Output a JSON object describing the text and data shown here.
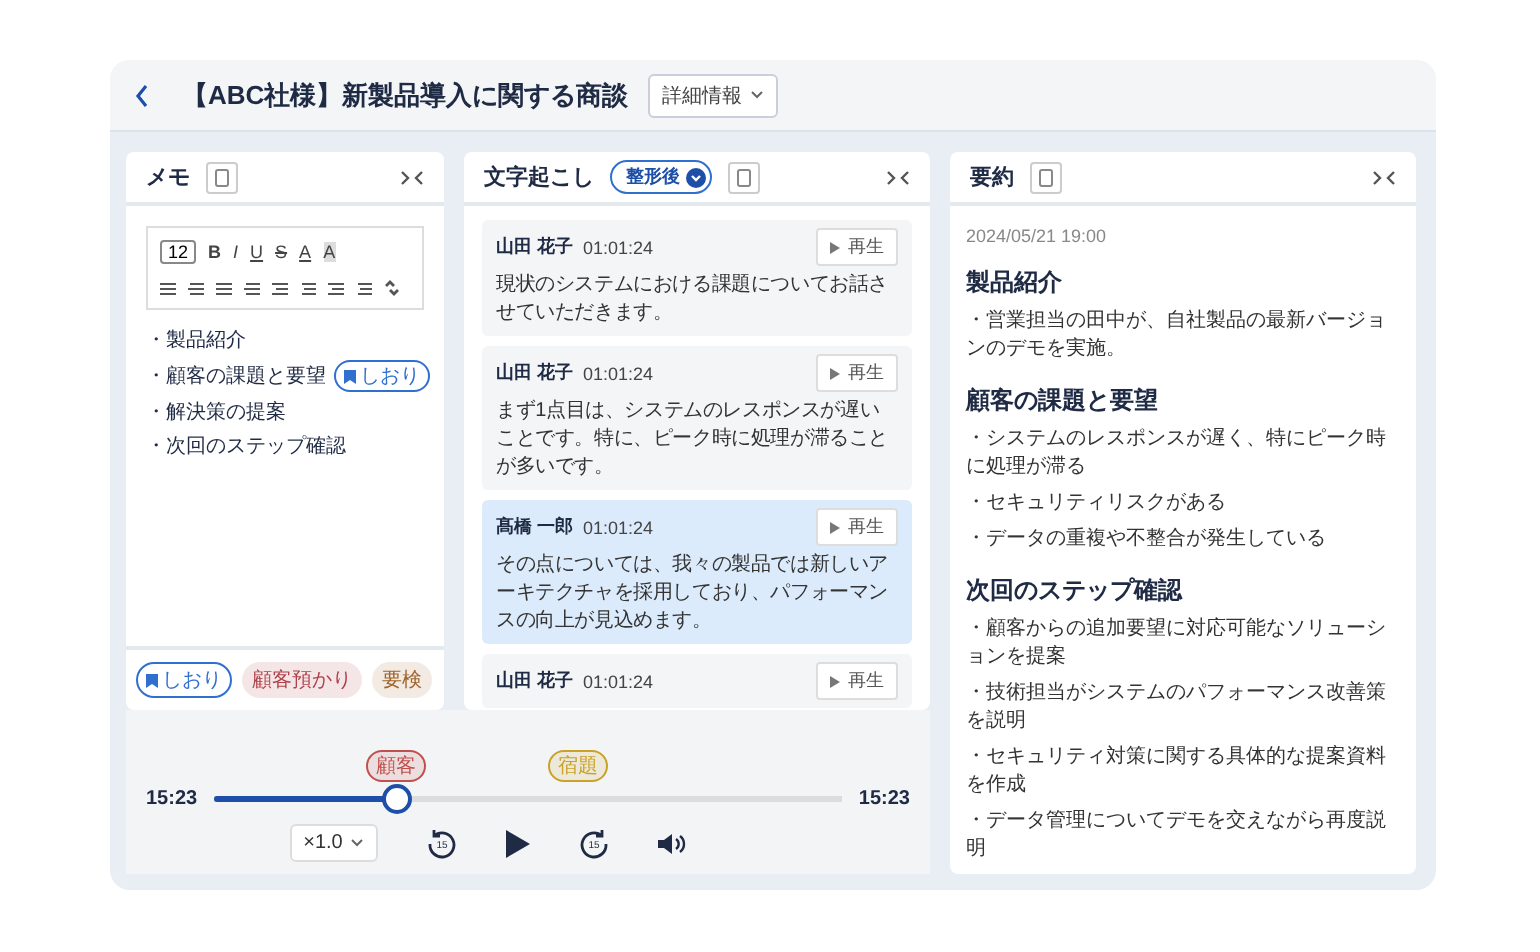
{
  "header": {
    "title": "【ABC社様】新製品導入に関する商談",
    "details_button": "詳細情報"
  },
  "memo": {
    "title": "メモ",
    "toolbar": {
      "font_size": "12",
      "buttons": [
        {
          "label": "B",
          "kind": "bold"
        },
        {
          "label": "I",
          "kind": "italic"
        },
        {
          "label": "U",
          "kind": "underline"
        },
        {
          "label": "S",
          "kind": "strike"
        },
        {
          "label": "A",
          "kind": "color"
        },
        {
          "label": "A",
          "kind": "highlight"
        }
      ]
    },
    "items": [
      {
        "text": "・製品紹介"
      },
      {
        "text": "・顧客の課題と要望",
        "bookmark": "しおり"
      },
      {
        "text": "・解決策の提案"
      },
      {
        "text": "・次回のステップ確認"
      }
    ],
    "tags": [
      {
        "label": "しおり",
        "kind": "bookmark",
        "color": "#2f6fd0"
      },
      {
        "label": "顧客預かり",
        "kind": "plain",
        "color": "#b0414a"
      },
      {
        "label": "要検",
        "kind": "plain",
        "color": "#a0632a"
      }
    ]
  },
  "transcript": {
    "title": "文字起こし",
    "toggle": {
      "label": "整形後",
      "on": true
    },
    "entries": [
      {
        "speaker": "山田 花子",
        "time": "01:01:24",
        "play": "再生",
        "text": "現状のシステムにおける課題についてお話させていただきます。",
        "highlighted": false
      },
      {
        "speaker": "山田 花子",
        "time": "01:01:24",
        "play": "再生",
        "text": "まず1点目は、システムのレスポンスが遅いことです。特に、ピーク時に処理が滞ることが多いです。",
        "highlighted": false
      },
      {
        "speaker": "髙橋 一郎",
        "time": "01:01:24",
        "play": "再生",
        "text": "その点については、我々の製品では新しいアーキテクチャを採用しており、パフォーマンスの向上が見込めます。",
        "highlighted": true
      },
      {
        "speaker": "山田 花子",
        "time": "01:01:24",
        "play": "再生",
        "highlighted": false
      }
    ]
  },
  "player": {
    "current": "15:23",
    "total": "15:23",
    "level": 0.29,
    "markers": [
      {
        "label": "顧客",
        "level": 0.29,
        "color": "#c0504d"
      },
      {
        "label": "宿題",
        "level": 0.58,
        "color": "#c9a227"
      }
    ],
    "speed": "×1.0",
    "skip_back": "15",
    "skip_forward": "15"
  },
  "summary": {
    "title": "要約",
    "date": "2024/05/21 19:00",
    "sections": [
      {
        "heading": "製品紹介",
        "lines": [
          "・営業担当の田中が、自社製品の最新バージョンのデモを実施。"
        ]
      },
      {
        "heading": "顧客の課題と要望",
        "lines": [
          "・システムのレスポンスが遅く、特にピーク時に処理が滞る",
          "・セキュリティリスクがある",
          "・データの重複や不整合が発生している"
        ]
      },
      {
        "heading": "次回のステップ確認",
        "lines": [
          "・顧客からの追加要望に対応可能なソリューションを提案",
          "・技術担当がシステムのパフォーマンス改善策を説明",
          "・セキュリティ対策に関する具体的な提案資料を作成",
          "・データ管理についてデモを交えながら再度説明"
        ]
      }
    ]
  }
}
